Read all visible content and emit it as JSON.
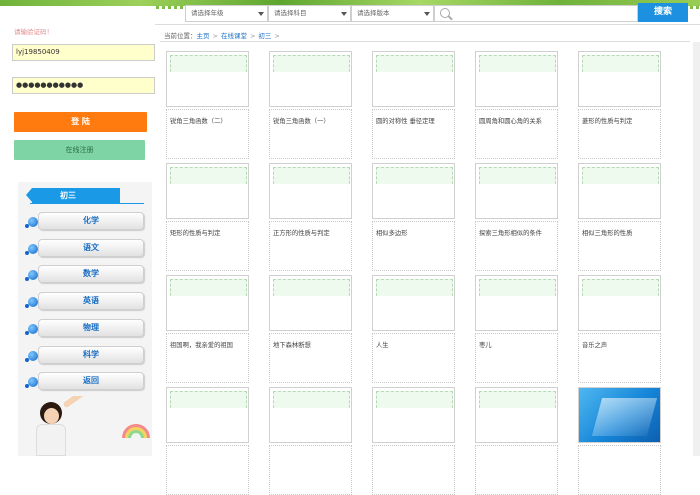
{
  "search": {
    "grade_placeholder": "请选择年级",
    "subject_placeholder": "请选择科目",
    "edition_placeholder": "请选择版本",
    "button_label": "搜索"
  },
  "login": {
    "code_hint": "请输验证码！",
    "username": "lyj19850409",
    "password": "●●●●●●●●●●●",
    "login_label": "登 陆",
    "register_label": "在线注册"
  },
  "subjects": {
    "grade": "初三",
    "items": [
      "化学",
      "语文",
      "数学",
      "英语",
      "物理",
      "科学",
      "返回"
    ]
  },
  "breadcrumb": {
    "prefix": "当前位置：",
    "items": [
      "主页",
      "在线课堂",
      "初三"
    ]
  },
  "courses": [
    "锐角三角函数（二）",
    "锐角三角函数（一）",
    "圆的对称性 垂径定理",
    "圆周角和圆心角的关系",
    "菱形的性质与判定",
    "矩形的性质与判定",
    "正方形的性质与判定",
    "相似多边形",
    "探索三角形相似的条件",
    "相似三角形的性质",
    "祖国啊，我亲爱的祖国",
    "地下森林断想",
    "人生",
    "枣儿",
    "音乐之声",
    "",
    "",
    "",
    "",
    ""
  ],
  "colors": {
    "search_button": "#1e90e0",
    "login_button": "#ff7b10",
    "register_button": "#7fd4a6",
    "link": "#1a6fc4",
    "grade_tab": "#1a9ae6"
  }
}
